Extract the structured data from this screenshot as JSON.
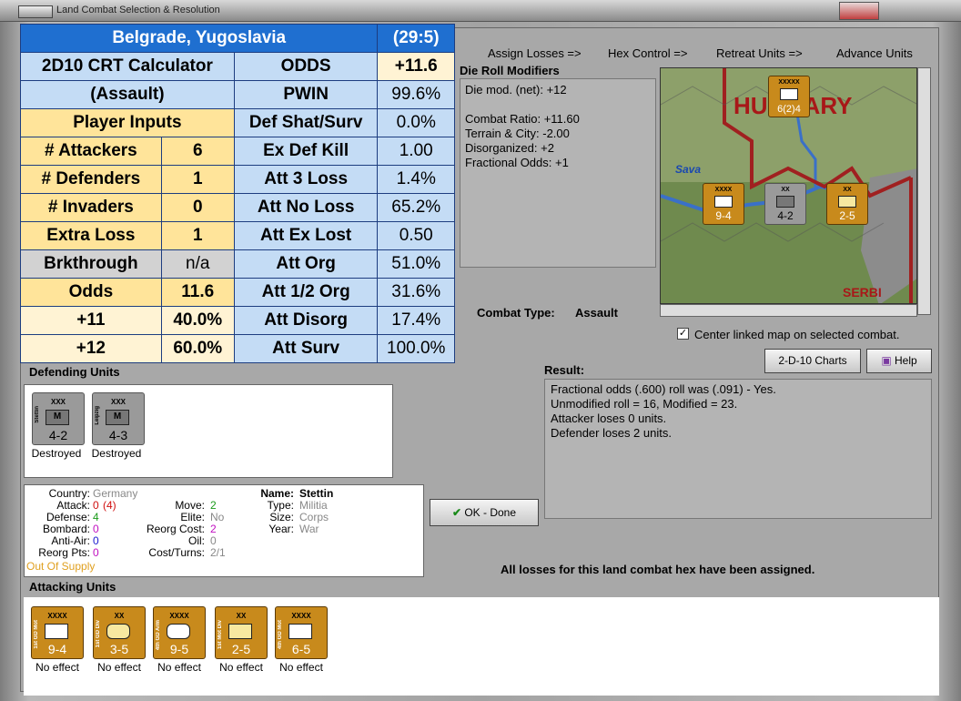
{
  "window": {
    "title": "Land Combat Selection & Resolution"
  },
  "crt": {
    "location": "Belgrade, Yugoslavia",
    "date": "(29:5)",
    "calc_title": "2D10 CRT Calculator",
    "calc_subtitle": "(Assault)",
    "player_inputs": "Player Inputs",
    "inputs": [
      {
        "label": "# Attackers",
        "value": "6"
      },
      {
        "label": "# Defenders",
        "value": "1"
      },
      {
        "label": "# Invaders",
        "value": "0"
      },
      {
        "label": "Extra Loss",
        "value": "1"
      },
      {
        "label": "Brkthrough",
        "value": "n/a"
      },
      {
        "label": "Odds",
        "value": "11.6"
      },
      {
        "label": "+11",
        "value": "40.0%"
      },
      {
        "label": "+12",
        "value": "60.0%"
      }
    ],
    "stats": [
      {
        "label": "ODDS",
        "value": "+11.6"
      },
      {
        "label": "PWIN",
        "value": "99.6%"
      },
      {
        "label": "Def Shat/Surv",
        "value": "0.0%"
      },
      {
        "label": "Ex Def Kill",
        "value": "1.00"
      },
      {
        "label": "Att 3 Loss",
        "value": "1.4%"
      },
      {
        "label": "Att No Loss",
        "value": "65.2%"
      },
      {
        "label": "Att Ex Lost",
        "value": "0.50"
      },
      {
        "label": "Att Org",
        "value": "51.0%"
      },
      {
        "label": "Att 1/2 Org",
        "value": "31.6%"
      },
      {
        "label": "Att Disorg",
        "value": "17.4%"
      },
      {
        "label": "Att Surv",
        "value": "100.0%"
      }
    ]
  },
  "menu": {
    "assign": "Assign Losses =>",
    "hex": "Hex Control =>",
    "retreat": "Retreat Units =>",
    "advance": "Advance Units"
  },
  "modifiers": {
    "title": "Die Roll Modifiers",
    "lines": [
      "Die mod. (net): +12",
      "",
      "Combat Ratio: +11.60",
      "Terrain & City: -2.00",
      "Disorganized: +2",
      "Fractional Odds: +1"
    ]
  },
  "map": {
    "country": "HUNGARY",
    "country2": "SERBI",
    "river": "Sava",
    "units": [
      {
        "size": "XXXX",
        "str": "9-4"
      },
      {
        "size": "XX",
        "str": "4-2"
      },
      {
        "size": "XX",
        "str": "2-5"
      },
      {
        "size": "XXXXX",
        "str": "6(2)4"
      }
    ]
  },
  "combat_type": {
    "label": "Combat Type:",
    "value": "Assault"
  },
  "center_map": {
    "label": "Center linked map on selected combat.",
    "checked": "✓"
  },
  "buttons": {
    "charts": "2-D-10 Charts",
    "help": "Help",
    "ok": "OK - Done"
  },
  "result": {
    "title": "Result:",
    "lines": [
      "Fractional odds (.600) roll was (.091)  - Yes.",
      "Unmodified roll = 16, Modified = 23.",
      "Attacker loses 0 units.",
      "Defender loses 2 units."
    ]
  },
  "defending": {
    "title": "Defending Units",
    "units": [
      {
        "name": "Stettin",
        "size": "XXX",
        "type": "M",
        "str": "4-2",
        "status": "Destroyed"
      },
      {
        "name": "Leipzig",
        "size": "XXX",
        "type": "M",
        "str": "4-3",
        "status": "Destroyed"
      }
    ]
  },
  "info": {
    "country_l": "Country:",
    "country": "Germany",
    "attack_l": "Attack:",
    "attack": "0",
    "attack2": "(4)",
    "defense_l": "Defense:",
    "defense": "4",
    "bombard_l": "Bombard:",
    "bombard": "0",
    "aa_l": "Anti-Air:",
    "aa": "0",
    "reorg_l": "Reorg Pts:",
    "reorg": "0",
    "supply": "Out Of Supply",
    "move_l": "Move:",
    "move": "2",
    "elite_l": "Elite:",
    "elite": "No",
    "rcost_l": "Reorg Cost:",
    "rcost": "2",
    "oil_l": "Oil:",
    "oil": "0",
    "ct_l": "Cost/Turns:",
    "ct": "2/1",
    "name_l": "Name:",
    "name": "Stettin",
    "type_l": "Type:",
    "type": "Militia",
    "size_l": "Size:",
    "size": "Corps",
    "year_l": "Year:",
    "year": "War"
  },
  "status_msg": "All losses for this land combat hex have been assigned.",
  "attacking": {
    "title": "Attacking Units",
    "units": [
      {
        "name": "1st GD Mot",
        "size": "XXXX",
        "str": "9-4",
        "status": "No effect"
      },
      {
        "name": "1st GD Div",
        "size": "XX",
        "str": "3-5",
        "status": "No effect"
      },
      {
        "name": "4th GD Arm",
        "size": "XXXX",
        "str": "9-5",
        "status": "No effect"
      },
      {
        "name": "1st Mot Div",
        "size": "XX",
        "str": "2-5",
        "status": "No effect"
      },
      {
        "name": "4th GD Mot",
        "size": "XXXX",
        "str": "6-5",
        "status": "No effect"
      }
    ]
  },
  "colors": {
    "header": "#1f6fd0",
    "blue_cell": "#c4dcf5",
    "gold_cell": "#ffe49a",
    "unit": "#c88a1c",
    "supply": "#e0a020"
  }
}
